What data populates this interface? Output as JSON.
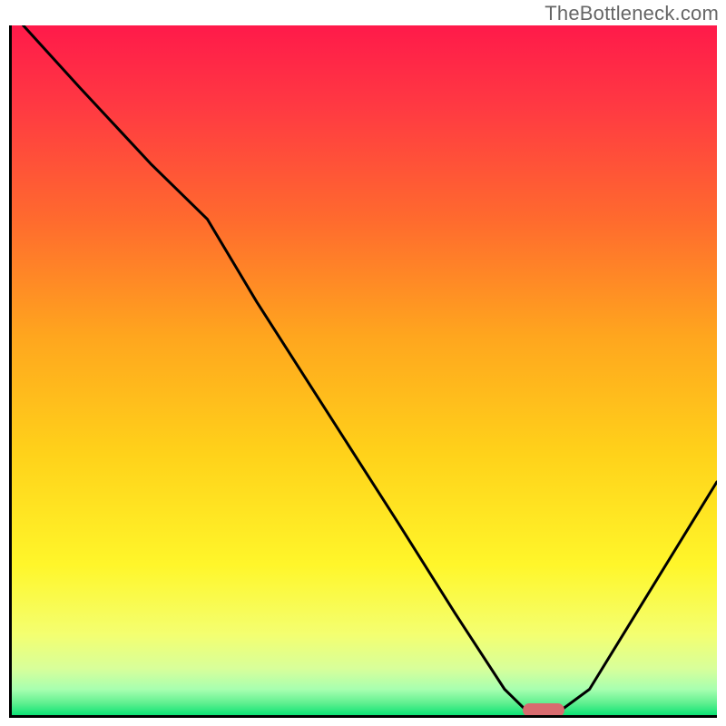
{
  "watermark": "TheBottleneck.com",
  "chart_data": {
    "type": "line",
    "title": "",
    "xlabel": "",
    "ylabel": "",
    "xlim": [
      0,
      100
    ],
    "ylim": [
      0,
      100
    ],
    "grid": false,
    "legend": false,
    "background_gradient": {
      "top": "#ff1a4a",
      "upper_mid": "#ff7a2a",
      "mid": "#ffd21a",
      "lower_mid": "#f8ff6a",
      "lower": "#d8ff9a",
      "bottom": "#00e070"
    },
    "series": [
      {
        "name": "bottleneck-curve",
        "x": [
          2,
          10,
          20,
          28,
          35,
          45,
          55,
          63,
          70,
          73,
          78,
          82,
          88,
          94,
          100
        ],
        "y": [
          100,
          91,
          80,
          72,
          60,
          44,
          28,
          15,
          4,
          1,
          1,
          4,
          14,
          24,
          34
        ]
      }
    ],
    "marker": {
      "name": "optimal-point",
      "x": 75.5,
      "y": 1,
      "color": "#d86b6f"
    }
  }
}
